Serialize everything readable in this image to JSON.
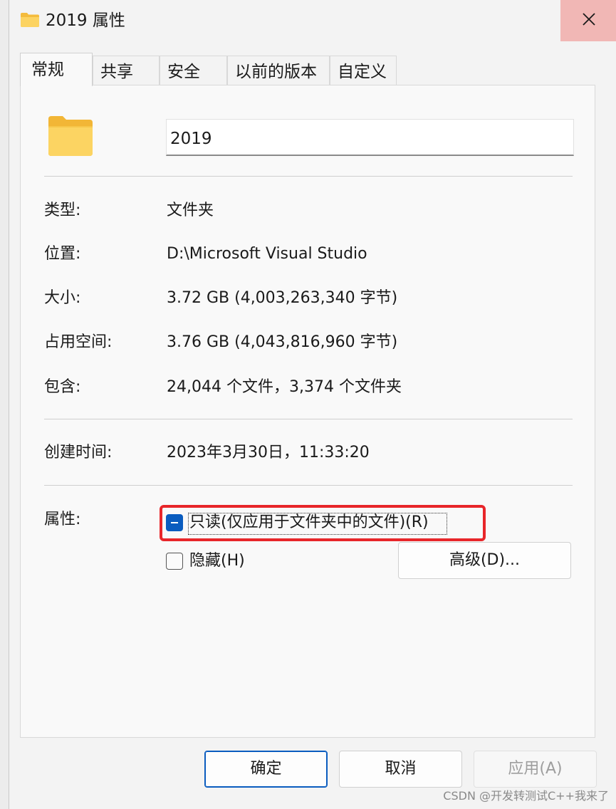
{
  "window": {
    "title": "2019 属性"
  },
  "tabs": [
    {
      "label": "常规",
      "active": true
    },
    {
      "label": "共享"
    },
    {
      "label": "安全"
    },
    {
      "label": "以前的版本"
    },
    {
      "label": "自定义"
    }
  ],
  "general": {
    "name_value": "2019",
    "properties": [
      {
        "label": "类型:",
        "value": "文件夹"
      },
      {
        "label": "位置:",
        "value": "D:\\Microsoft Visual Studio"
      },
      {
        "label": "大小:",
        "value": "3.72 GB (4,003,263,340 字节)"
      },
      {
        "label": "占用空间:",
        "value": "3.76 GB (4,043,816,960 字节)"
      },
      {
        "label": "包含:",
        "value": "24,044 个文件，3,374 个文件夹"
      }
    ],
    "created": {
      "label": "创建时间:",
      "value": "2023年3月30日，11:33:20"
    },
    "attributes": {
      "label": "属性:",
      "readonly_label": "只读(仅应用于文件夹中的文件)(R)",
      "readonly_state": "mixed",
      "hidden_label": "隐藏(H)",
      "hidden_state": "unchecked",
      "advanced_label": "高级(D)..."
    }
  },
  "footer": {
    "ok_label": "确定",
    "cancel_label": "取消",
    "apply_label": "应用(A)"
  },
  "watermark": "CSDN @开发转测试C++我来了",
  "colors": {
    "accent": "#0a5cbf",
    "close_hover": "#f1b7b5",
    "highlight": "#e8262a"
  },
  "icons": {
    "title": "folder-icon",
    "close": "close-icon",
    "large": "folder-icon"
  }
}
